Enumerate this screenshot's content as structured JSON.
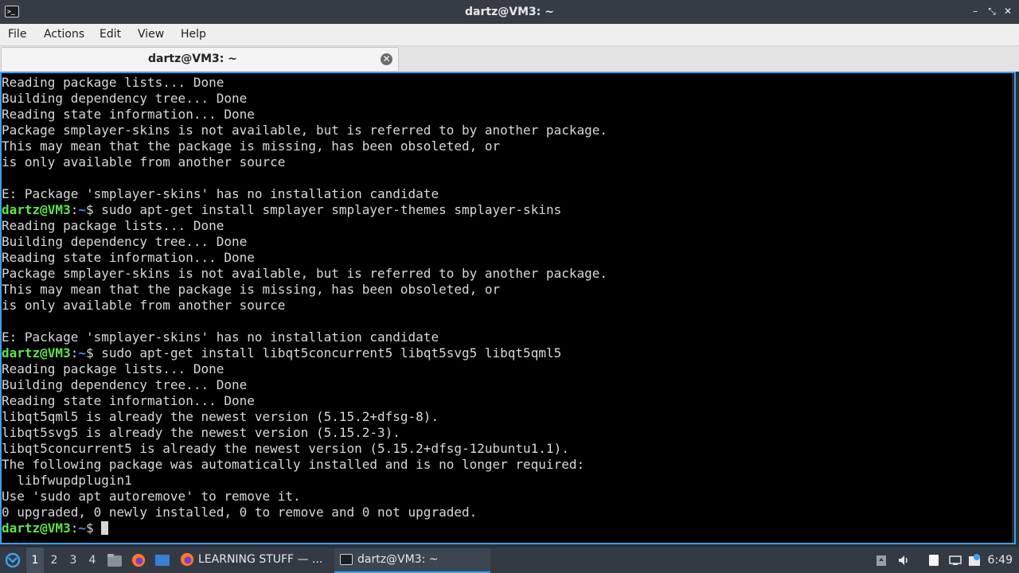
{
  "window": {
    "title": "dartz@VM3: ~",
    "app_icon": "terminal-icon",
    "controls": {
      "minimize": "–",
      "maximize": "⤡",
      "close": "✕"
    }
  },
  "menu": [
    "File",
    "Actions",
    "Edit",
    "View",
    "Help"
  ],
  "tab": {
    "label": "dartz@VM3: ~",
    "close_glyph": "✕"
  },
  "terminal": {
    "prompt_user": "dartz@VM3",
    "prompt_sep": ":",
    "prompt_path": "~",
    "prompt_symbol": "$ ",
    "lines": [
      {
        "text": "Reading package lists... Done"
      },
      {
        "text": "Building dependency tree... Done"
      },
      {
        "text": "Reading state information... Done"
      },
      {
        "text": "Package smplayer-skins is not available, but is referred to by another package."
      },
      {
        "text": "This may mean that the package is missing, has been obsoleted, or"
      },
      {
        "text": "is only available from another source"
      },
      {
        "text": ""
      },
      {
        "text": "E: Package 'smplayer-skins' has no installation candidate"
      },
      {
        "prompt": true,
        "text": "sudo apt-get install smplayer smplayer-themes smplayer-skins"
      },
      {
        "text": "Reading package lists... Done"
      },
      {
        "text": "Building dependency tree... Done"
      },
      {
        "text": "Reading state information... Done"
      },
      {
        "text": "Package smplayer-skins is not available, but is referred to by another package."
      },
      {
        "text": "This may mean that the package is missing, has been obsoleted, or"
      },
      {
        "text": "is only available from another source"
      },
      {
        "text": ""
      },
      {
        "text": "E: Package 'smplayer-skins' has no installation candidate"
      },
      {
        "prompt": true,
        "text": "sudo apt-get install libqt5concurrent5 libqt5svg5 libqt5qml5"
      },
      {
        "text": "Reading package lists... Done"
      },
      {
        "text": "Building dependency tree... Done"
      },
      {
        "text": "Reading state information... Done"
      },
      {
        "text": "libqt5qml5 is already the newest version (5.15.2+dfsg-8)."
      },
      {
        "text": "libqt5svg5 is already the newest version (5.15.2-3)."
      },
      {
        "text": "libqt5concurrent5 is already the newest version (5.15.2+dfsg-12ubuntu1.1)."
      },
      {
        "text": "The following package was automatically installed and is no longer required:"
      },
      {
        "text": "  libfwupdplugin1"
      },
      {
        "text": "Use 'sudo apt autoremove' to remove it."
      },
      {
        "text": "0 upgraded, 0 newly installed, 0 to remove and 0 not upgraded."
      },
      {
        "prompt": true,
        "text": "",
        "cursor": true
      }
    ]
  },
  "taskbar": {
    "workspaces": [
      "1",
      "2",
      "3",
      "4"
    ],
    "active_workspace": "1",
    "tasks": [
      {
        "label": "LEARNING STUFF — ...",
        "icon": "firefox-icon"
      },
      {
        "label": "dartz@VM3: ~",
        "icon": "terminal-icon",
        "active": true
      }
    ],
    "clock": "6:49",
    "colors": {
      "accent": "#3a9ff0",
      "prompt_user": "#5fe34a",
      "prompt_path": "#4a8ef0"
    }
  }
}
